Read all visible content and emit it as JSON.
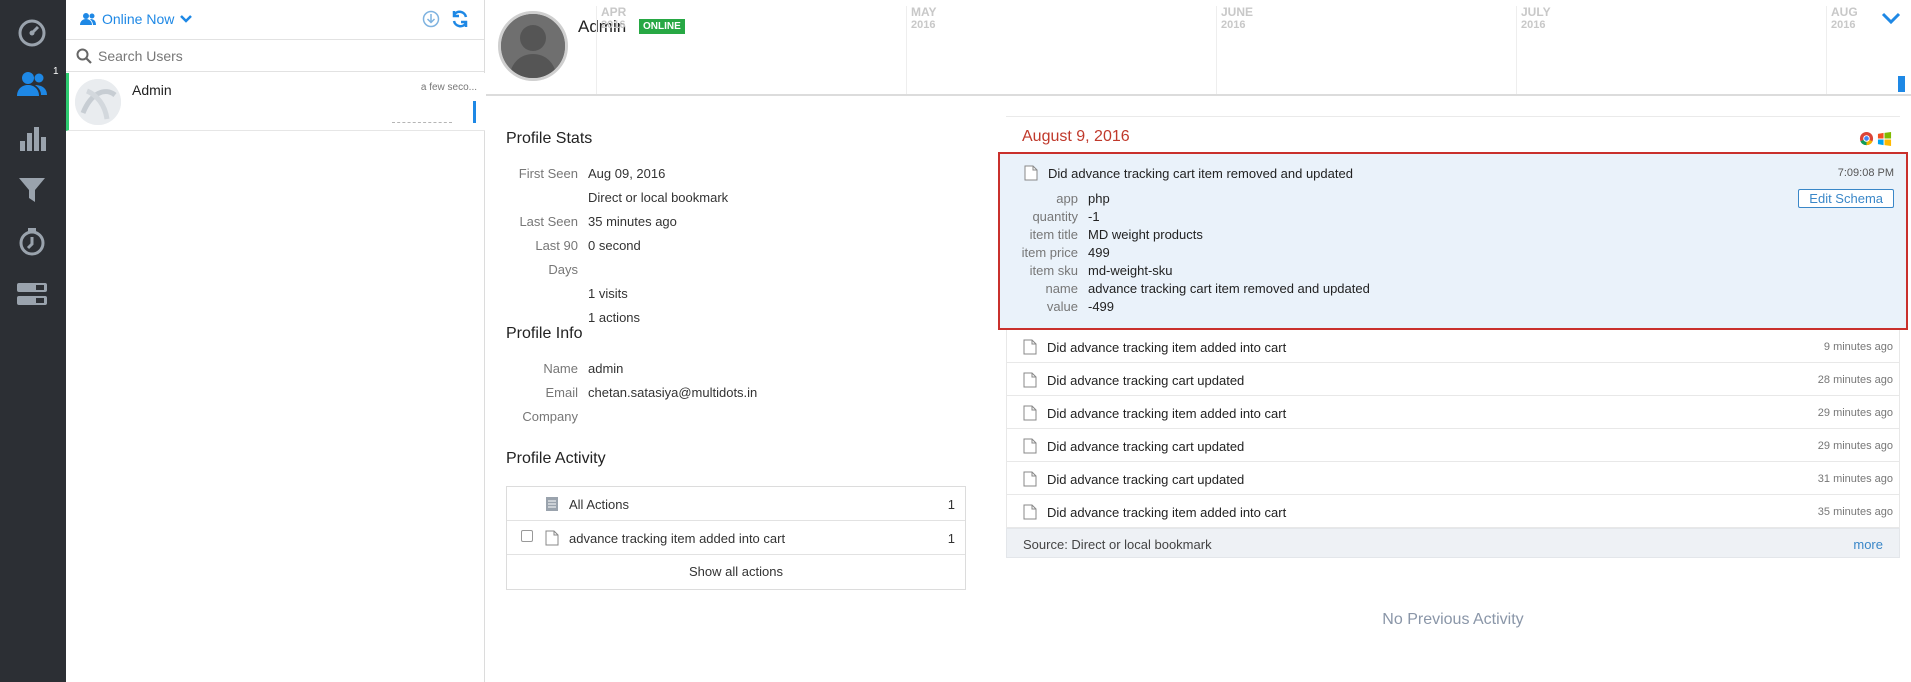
{
  "rail": {
    "items": [
      {
        "name": "dashboard-icon"
      },
      {
        "name": "users-icon",
        "badge": "1"
      },
      {
        "name": "analytics-icon"
      },
      {
        "name": "funnel-icon"
      },
      {
        "name": "retention-icon"
      },
      {
        "name": "settings-panels-icon"
      }
    ]
  },
  "user_panel": {
    "filter_label": "Online Now",
    "search_placeholder": "Search Users",
    "users": [
      {
        "name": "Admin",
        "time": "a few seco..."
      }
    ]
  },
  "header": {
    "name": "Admin",
    "status": "ONLINE",
    "months": [
      {
        "m": "APR",
        "y": "2016"
      },
      {
        "m": "MAY",
        "y": "2016"
      },
      {
        "m": "JUNE",
        "y": "2016"
      },
      {
        "m": "JULY",
        "y": "2016"
      },
      {
        "m": "AUG",
        "y": "2016"
      }
    ]
  },
  "profile_stats": {
    "title": "Profile Stats",
    "rows": [
      {
        "k": "First Seen",
        "v": "Aug 09, 2016"
      },
      {
        "k": "",
        "v": "Direct or local bookmark"
      },
      {
        "k": "Last Seen",
        "v": "35 minutes ago"
      },
      {
        "k": "Last 90 Days",
        "v": "0 second"
      },
      {
        "k": "",
        "v": "1 visits"
      },
      {
        "k": "",
        "v": "1 actions"
      }
    ]
  },
  "profile_info": {
    "title": "Profile Info",
    "rows": [
      {
        "k": "Name",
        "v": "admin"
      },
      {
        "k": "Email",
        "v": "chetan.satasiya@multidots.in"
      },
      {
        "k": "Company",
        "v": ""
      }
    ]
  },
  "profile_activity": {
    "title": "Profile Activity",
    "all_label": "All Actions",
    "all_count": "1",
    "item_label": "advance tracking item added into cart",
    "item_count": "1",
    "show_all": "Show all actions"
  },
  "events": {
    "date": "August 9, 2016",
    "expanded": {
      "title": "Did advance tracking cart item removed and updated",
      "time": "7:09:08 PM",
      "edit_label": "Edit Schema",
      "props": [
        {
          "k": "app",
          "v": "php"
        },
        {
          "k": "quantity",
          "v": "-1"
        },
        {
          "k": "item title",
          "v": "MD weight products"
        },
        {
          "k": "item price",
          "v": "499"
        },
        {
          "k": "item sku",
          "v": "md-weight-sku"
        },
        {
          "k": "name",
          "v": "advance tracking cart item removed and updated"
        },
        {
          "k": "value",
          "v": "-499"
        }
      ]
    },
    "list": [
      {
        "text": "Did advance tracking item added into cart",
        "time": "9 minutes ago"
      },
      {
        "text": "Did advance tracking cart updated",
        "time": "28 minutes ago"
      },
      {
        "text": "Did advance tracking item added into cart",
        "time": "29 minutes ago"
      },
      {
        "text": "Did advance tracking cart updated",
        "time": "29 minutes ago"
      },
      {
        "text": "Did advance tracking cart updated",
        "time": "31 minutes ago"
      },
      {
        "text": "Did advance tracking item added into cart",
        "time": "35 minutes ago"
      }
    ],
    "source": "Source: Direct or local bookmark",
    "more": "more"
  },
  "no_previous": "No Previous Activity",
  "colors": {
    "rail_bg": "#2c2f34",
    "accent": "#1e88e5",
    "online": "#27a844",
    "date_red": "#c0392b",
    "highlight_border": "#c9302c"
  }
}
